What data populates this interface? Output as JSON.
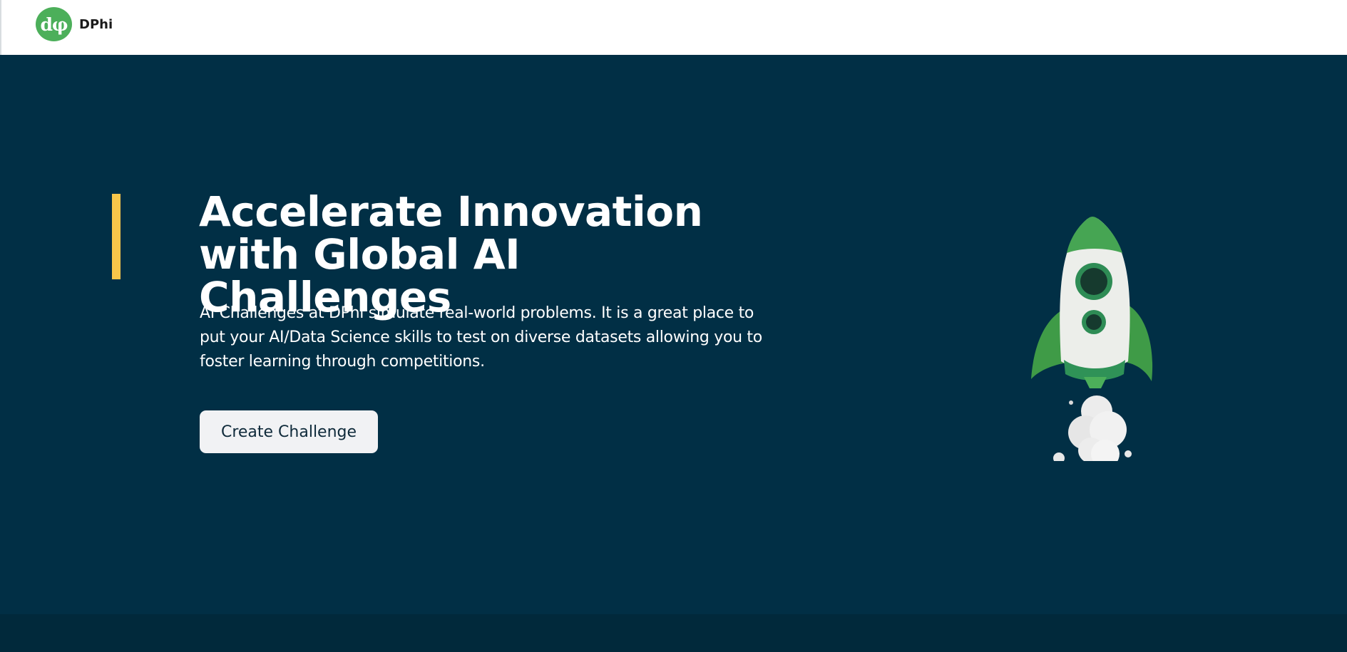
{
  "header": {
    "logo_mark": "dφ",
    "brand_name": "DPhi"
  },
  "hero": {
    "title": "Accelerate Innovation with Global AI Challenges",
    "description": "AI Challenges at DPhi simulate real-world problems. It is a great place to put your AI/Data Science skills to test on diverse datasets allowing you to foster learning through competitions.",
    "cta_label": "Create Challenge",
    "illustration": "rocket-illustration"
  },
  "colors": {
    "header_bg": "#ffffff",
    "hero_bg": "#012f45",
    "accent": "#f7c64a",
    "brand_green": "#4caf5a",
    "button_bg": "#f1f2f4",
    "footer_bg": "#01293b"
  }
}
